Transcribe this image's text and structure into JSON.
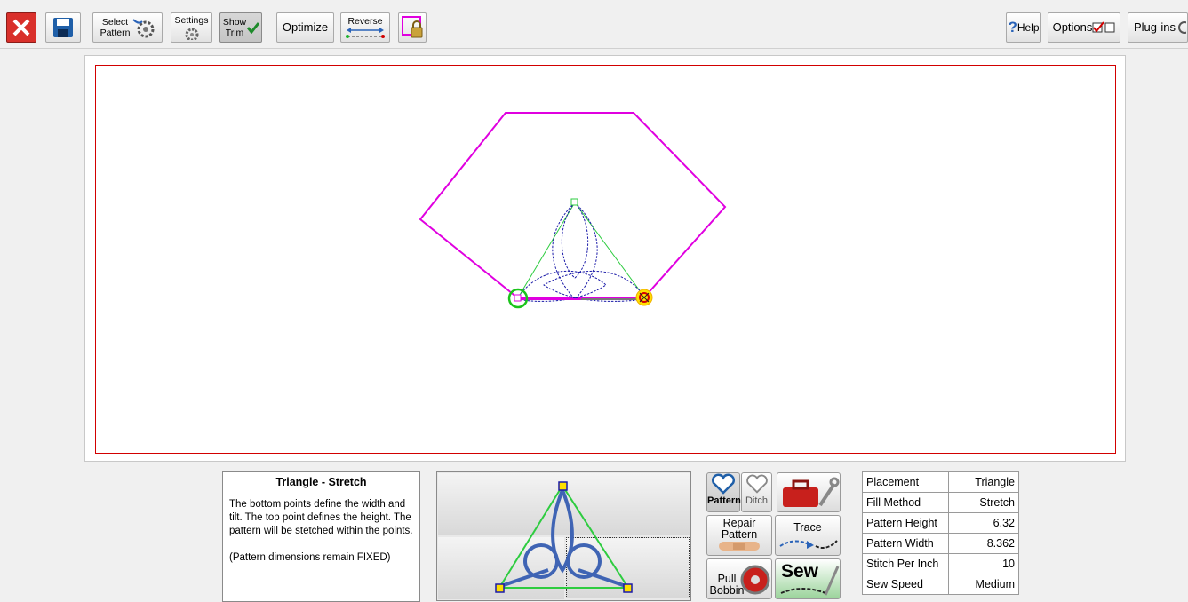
{
  "toolbar": {
    "select_pattern_label": "Select Pattern",
    "settings_label": "Settings",
    "show_trim_label": "Show Trim",
    "optimize_label": "Optimize",
    "reverse_label": "Reverse",
    "help_label": "Help",
    "options_label": "Options",
    "plugins_label": "Plug-ins"
  },
  "description": {
    "title": "Triangle - Stretch",
    "body": "The bottom points define the width and tilt. The top point defines the height. The pattern will be stetched within the points.",
    "note": "(Pattern dimensions remain FIXED)"
  },
  "tools": {
    "pattern_label": "Pattern",
    "ditch_label": "Ditch",
    "repair_label": "Repair Pattern",
    "trace_label": "Trace",
    "pull_bobbin_label": "Pull Bobbin",
    "sew_label": "Sew"
  },
  "properties": [
    {
      "label": "Placement",
      "value": "Triangle"
    },
    {
      "label": "Fill Method",
      "value": "Stretch"
    },
    {
      "label": "Pattern Height",
      "value": "6.32"
    },
    {
      "label": "Pattern Width",
      "value": "8.362"
    },
    {
      "label": "Stitch Per Inch",
      "value": "10"
    },
    {
      "label": "Sew Speed",
      "value": "Medium"
    }
  ],
  "icons": [
    "close-icon",
    "save-icon",
    "gear-icon",
    "checkmark-icon",
    "lock-icon",
    "help-icon",
    "toolbox-icon",
    "heart-icon",
    "bobbin-icon"
  ],
  "colors": {
    "hexagon": "#e000e0",
    "triangle": "#2ecc40",
    "pattern": "#1a1aa8",
    "border": "#d20000"
  }
}
